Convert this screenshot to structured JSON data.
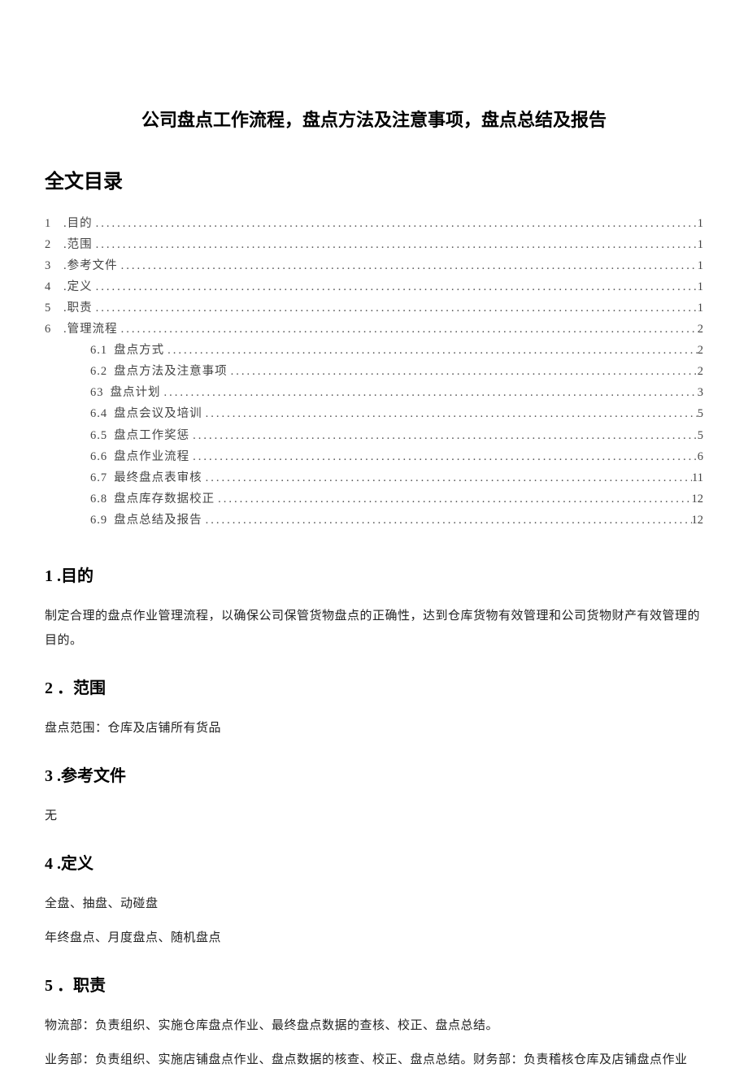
{
  "title": "公司盘点工作流程，盘点方法及注意事项，盘点总结及报告",
  "toc_heading": "全文目录",
  "toc_top": [
    {
      "num": "1",
      "label": ".目的",
      "page": "1"
    },
    {
      "num": "2",
      "label": ".范围",
      "page": "1"
    },
    {
      "num": "3",
      "label": ".参考文件",
      "page": "1"
    },
    {
      "num": "4",
      "label": ".定义",
      "page": "1"
    },
    {
      "num": "5",
      "label": ".职责",
      "page": "1"
    },
    {
      "num": "6",
      "label": ".管理流程",
      "page": "2"
    }
  ],
  "toc_sub": [
    {
      "num": "6.1",
      "label": "盘点方式",
      "page": "2"
    },
    {
      "num": "6.2",
      "label": "盘点方法及注意事项",
      "page": "2"
    },
    {
      "num": "63",
      "label": "盘点计划",
      "page": "3"
    },
    {
      "num": "6.4",
      "label": "盘点会议及培训",
      "page": "5"
    },
    {
      "num": "6.5",
      "label": "盘点工作奖惩",
      "page": "5"
    },
    {
      "num": "6.6",
      "label": "盘点作业流程",
      "page": "6"
    },
    {
      "num": "6.7",
      "label": "最终盘点表审核",
      "page": "11"
    },
    {
      "num": "6.8",
      "label": "盘点库存数据校正",
      "page": "12"
    },
    {
      "num": "6.9",
      "label": "盘点总结及报告",
      "page": "12"
    }
  ],
  "sections": {
    "s1": {
      "num": "1",
      "title": ".目的",
      "body": "制定合理的盘点作业管理流程，以确保公司保管货物盘点的正确性，达到仓库货物有效管理和公司货物财产有效管理的目的。"
    },
    "s2": {
      "num": "2",
      "title": "．范围",
      "body": "盘点范围：仓库及店铺所有货品"
    },
    "s3": {
      "num": "3",
      "title": ".参考文件",
      "body": "无"
    },
    "s4": {
      "num": "4",
      "title": ".定义",
      "body1": "全盘、抽盘、动碰盘",
      "body2": "年终盘点、月度盘点、随机盘点"
    },
    "s5": {
      "num": "5",
      "title": "．职责",
      "body1": "物流部：负责组织、实施仓库盘点作业、最终盘点数据的查核、校正、盘点总结。",
      "body2": "业务部：负责组织、实施店铺盘点作业、盘点数据的核查、校正、盘点总结。财务部：负责稽核仓库及店铺盘点作业"
    }
  }
}
